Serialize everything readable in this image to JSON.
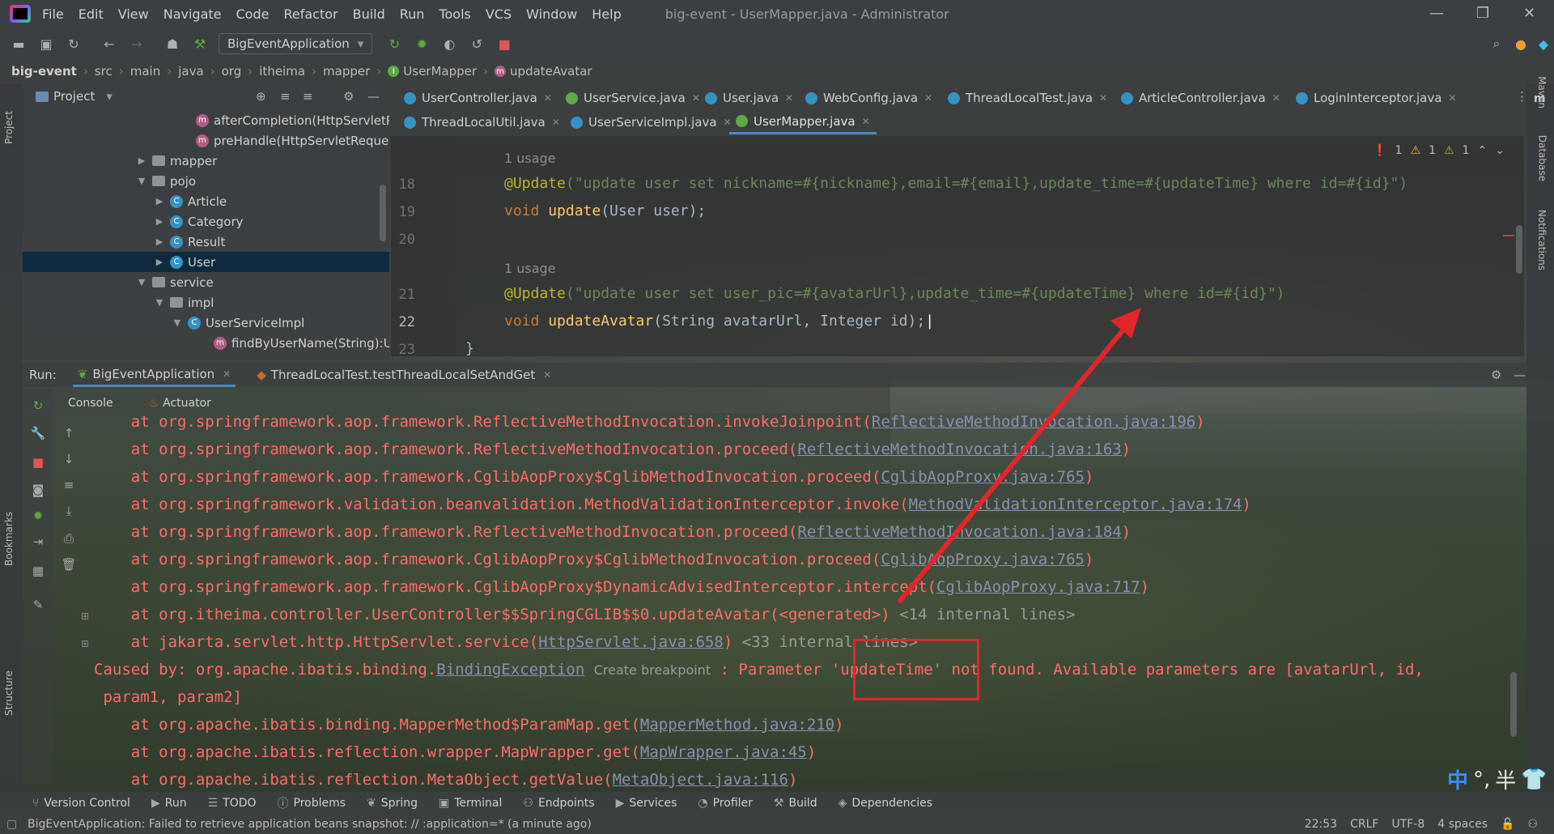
{
  "menu": {
    "items": [
      "File",
      "Edit",
      "View",
      "Navigate",
      "Code",
      "Refactor",
      "Build",
      "Run",
      "Tools",
      "VCS",
      "Window",
      "Help"
    ],
    "window_title": "big-event - UserMapper.java - Administrator"
  },
  "toolbar": {
    "run_config": "BigEventApplication"
  },
  "breadcrumb": [
    "big-event",
    "src",
    "main",
    "java",
    "org",
    "itheima",
    "mapper",
    "UserMapper",
    "updateAvatar"
  ],
  "project": {
    "header": "Project",
    "items": [
      {
        "label": "afterCompletion(HttpServletR",
        "kind": "method"
      },
      {
        "label": "preHandle(HttpServletReques",
        "kind": "method"
      },
      {
        "label": "mapper",
        "kind": "folder"
      },
      {
        "label": "pojo",
        "kind": "folder"
      },
      {
        "label": "Article",
        "kind": "class"
      },
      {
        "label": "Category",
        "kind": "class"
      },
      {
        "label": "Result",
        "kind": "class"
      },
      {
        "label": "User",
        "kind": "class"
      },
      {
        "label": "service",
        "kind": "folder"
      },
      {
        "label": "impl",
        "kind": "folder"
      },
      {
        "label": "UserServiceImpl",
        "kind": "class"
      },
      {
        "label": "findByUserName(String):Us",
        "kind": "method"
      }
    ]
  },
  "tabs": {
    "row1": [
      "UserController.java",
      "UserService.java",
      "User.java",
      "WebConfig.java",
      "ThreadLocalTest.java",
      "ArticleController.java",
      "LoginInterceptor.java"
    ],
    "row2": [
      "ThreadLocalUtil.java",
      "UserServiceImpl.java",
      "UserMapper.java"
    ]
  },
  "editor": {
    "usage_hint": "1 usage",
    "line_numbers": [
      "18",
      "19",
      "20",
      "21",
      "22",
      "23"
    ],
    "line18_anno": "@Update",
    "line18_str": "(\"update user set nickname=#{nickname},email=#{email},update_time=#{updateTime} where id=#{id}\")",
    "line19_kw": "void ",
    "line19_fn": "update",
    "line19_rest": "(User user);",
    "line21_anno": "@Update",
    "line21_str": "(\"update user set user_pic=#{avatarUrl},update_time=#{updateTime} where id=#{id}\")",
    "line22_kw": "void ",
    "line22_fn": "updateAvatar",
    "line22_rest": "(String avatarUrl, Integer id);",
    "line23": "}",
    "inspections": {
      "errors": "1",
      "warnings": "1",
      "weak": "1"
    }
  },
  "run": {
    "label": "Run:",
    "tabs": [
      "BigEventApplication",
      "ThreadLocalTest.testThreadLocalSetAndGet"
    ],
    "subtabs": [
      "Console",
      "Actuator"
    ]
  },
  "console": {
    "lines": [
      {
        "pre": "    at org.springframework.aop.framework.ReflectiveMethodInvocation.invokeJoinpoint(",
        "link": "ReflectiveMethodInvocation.java:196",
        "post": ")"
      },
      {
        "pre": "    at org.springframework.aop.framework.ReflectiveMethodInvocation.proceed(",
        "link": "ReflectiveMethodInvocation.java:163",
        "post": ")"
      },
      {
        "pre": "    at org.springframework.aop.framework.CglibAopProxy$CglibMethodInvocation.proceed(",
        "link": "CglibAopProxy.java:765",
        "post": ")"
      },
      {
        "pre": "    at org.springframework.validation.beanvalidation.MethodValidationInterceptor.invoke(",
        "link": "MethodValidationInterceptor.java:174",
        "post": ")"
      },
      {
        "pre": "    at org.springframework.aop.framework.ReflectiveMethodInvocation.proceed(",
        "link": "ReflectiveMethodInvocation.java:184",
        "post": ")"
      },
      {
        "pre": "    at org.springframework.aop.framework.CglibAopProxy$CglibMethodInvocation.proceed(",
        "link": "CglibAopProxy.java:765",
        "post": ")"
      },
      {
        "pre": "    at org.springframework.aop.framework.CglibAopProxy$DynamicAdvisedInterceptor.intercept(",
        "link": "CglibAopProxy.java:717",
        "post": ")"
      },
      {
        "pre": "    at org.itheima.controller.UserController$$SpringCGLIB$$0.updateAvatar(<generated>)",
        "link": "",
        "post": "",
        "gray": " <14 internal lines>"
      },
      {
        "pre": "    at jakarta.servlet.http.HttpServlet.service(",
        "link": "HttpServlet.java:658",
        "post": ")",
        "gray": " <33 internal lines>"
      }
    ],
    "caused_pre": "Caused by: org.apache.ibatis.binding.",
    "caused_link": "BindingException",
    "create_breakpoint": "Create breakpoint",
    "caused_post": ": Parameter 'updateTime' not found. Available parameters are [avatarUrl, id,",
    "caused_cont": " param1, param2]",
    "tail": [
      {
        "pre": "    at org.apache.ibatis.binding.MapperMethod$ParamMap.get(",
        "link": "MapperMethod.java:210",
        "post": ")"
      },
      {
        "pre": "    at org.apache.ibatis.reflection.wrapper.MapWrapper.get(",
        "link": "MapWrapper.java:45",
        "post": ")"
      },
      {
        "pre": "    at org.apache.ibatis.reflection.MetaObject.getValue(",
        "link": "MetaObject.java:116",
        "post": ")"
      }
    ]
  },
  "ime": {
    "zh": "中",
    "punct": "°,",
    "half": "半"
  },
  "side_labels": {
    "left": [
      "Project",
      "Bookmarks",
      "Structure"
    ],
    "right": [
      "Maven",
      "Database",
      "Notifications"
    ]
  },
  "bottom_tools": [
    "Version Control",
    "Run",
    "TODO",
    "Problems",
    "Spring",
    "Terminal",
    "Endpoints",
    "Services",
    "Profiler",
    "Build",
    "Dependencies"
  ],
  "status": {
    "message": "BigEventApplication: Failed to retrieve application beans snapshot: // :application=* (a minute ago)",
    "position": "22:53",
    "line_sep": "CRLF",
    "encoding": "UTF-8",
    "indent": "4 spaces"
  }
}
